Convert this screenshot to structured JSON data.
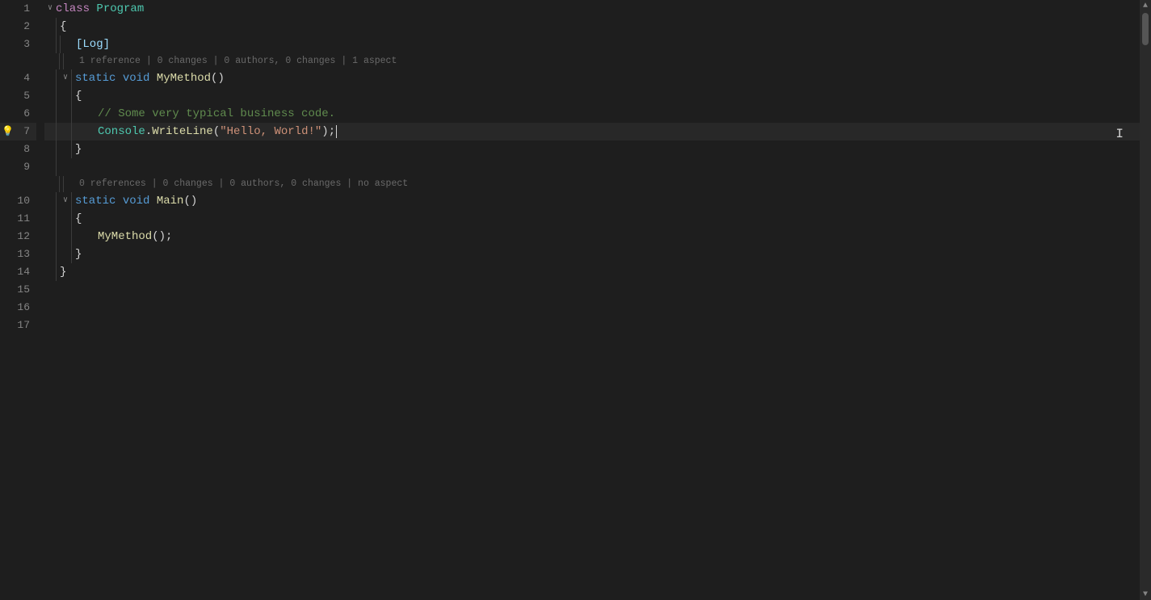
{
  "editor": {
    "background": "#1e1e1e",
    "active_line": 7,
    "lines": [
      {
        "num": 1,
        "type": "code",
        "indent": 0,
        "collapse": true,
        "content": "class Program",
        "tokens": [
          {
            "t": "kw2",
            "v": "class "
          },
          {
            "t": "cls",
            "v": "Program"
          }
        ]
      },
      {
        "num": 2,
        "type": "code",
        "indent": 1,
        "content": "{",
        "tokens": [
          {
            "t": "bracket",
            "v": "{"
          }
        ]
      },
      {
        "num": 3,
        "type": "code",
        "indent": 2,
        "content": "    [Log]",
        "tokens": [
          {
            "t": "attr",
            "v": "[Log]"
          }
        ]
      },
      {
        "num": "3m",
        "type": "meta",
        "content": "1 reference | 0 changes | 0 authors, 0 changes | 1 aspect"
      },
      {
        "num": 4,
        "type": "code",
        "indent": 2,
        "collapse": true,
        "content": "    static void MyMethod()",
        "tokens": [
          {
            "t": "kw",
            "v": "static "
          },
          {
            "t": "kw",
            "v": "void "
          },
          {
            "t": "method",
            "v": "MyMethod"
          },
          {
            "t": "bracket",
            "v": "()"
          }
        ]
      },
      {
        "num": 5,
        "type": "code",
        "indent": 2,
        "content": "    {",
        "tokens": [
          {
            "t": "bracket",
            "v": "{"
          }
        ]
      },
      {
        "num": 6,
        "type": "code",
        "indent": 3,
        "content": "        // Some very typical business code.",
        "tokens": [
          {
            "t": "comment",
            "v": "// Some very typical business code."
          }
        ]
      },
      {
        "num": 7,
        "type": "code",
        "indent": 3,
        "active": true,
        "content": "        Console.WriteLine(\"Hello, World!\");",
        "tokens": [
          {
            "t": "console-cls",
            "v": "Console"
          },
          {
            "t": "punct",
            "v": "."
          },
          {
            "t": "method",
            "v": "WriteLine"
          },
          {
            "t": "bracket",
            "v": "("
          },
          {
            "t": "str",
            "v": "\"Hello, World!\""
          },
          {
            "t": "bracket",
            "v": ")"
          },
          {
            "t": "punct",
            "v": ";"
          }
        ],
        "cursor": true
      },
      {
        "num": 8,
        "type": "code",
        "indent": 2,
        "content": "    }",
        "tokens": [
          {
            "t": "bracket",
            "v": "}"
          }
        ]
      },
      {
        "num": 9,
        "type": "code",
        "indent": 0,
        "content": ""
      },
      {
        "num": "9m",
        "type": "meta",
        "content": "0 references | 0 changes | 0 authors, 0 changes | no aspect"
      },
      {
        "num": 10,
        "type": "code",
        "indent": 2,
        "collapse": true,
        "content": "    static void Main()",
        "tokens": [
          {
            "t": "kw",
            "v": "static "
          },
          {
            "t": "kw",
            "v": "void "
          },
          {
            "t": "method",
            "v": "Main"
          },
          {
            "t": "bracket",
            "v": "()"
          }
        ]
      },
      {
        "num": 11,
        "type": "code",
        "indent": 2,
        "content": "    {",
        "tokens": [
          {
            "t": "bracket",
            "v": "{"
          }
        ]
      },
      {
        "num": 12,
        "type": "code",
        "indent": 3,
        "content": "        MyMethod();",
        "tokens": [
          {
            "t": "method",
            "v": "MyMethod"
          },
          {
            "t": "bracket",
            "v": "()"
          },
          {
            "t": "punct",
            "v": ";"
          }
        ]
      },
      {
        "num": 13,
        "type": "code",
        "indent": 2,
        "content": "    }",
        "tokens": [
          {
            "t": "bracket",
            "v": "}"
          }
        ]
      },
      {
        "num": 14,
        "type": "code",
        "indent": 1,
        "content": "}",
        "tokens": [
          {
            "t": "bracket",
            "v": "}"
          }
        ]
      },
      {
        "num": 15,
        "type": "code",
        "indent": 0,
        "content": ""
      },
      {
        "num": 16,
        "type": "code",
        "indent": 0,
        "content": ""
      },
      {
        "num": 17,
        "type": "code",
        "indent": 0,
        "content": ""
      }
    ],
    "line_numbers": [
      1,
      2,
      3,
      4,
      5,
      6,
      7,
      8,
      9,
      10,
      11,
      12,
      13,
      14,
      15,
      16,
      17
    ],
    "meta_line_1_ref": "1 reference | 0 changes | 0 authors, 0 changes | 1 aspect",
    "meta_line_2_ref": "0 references | 0 changes | 0 authors, 0 changes | no aspect"
  }
}
